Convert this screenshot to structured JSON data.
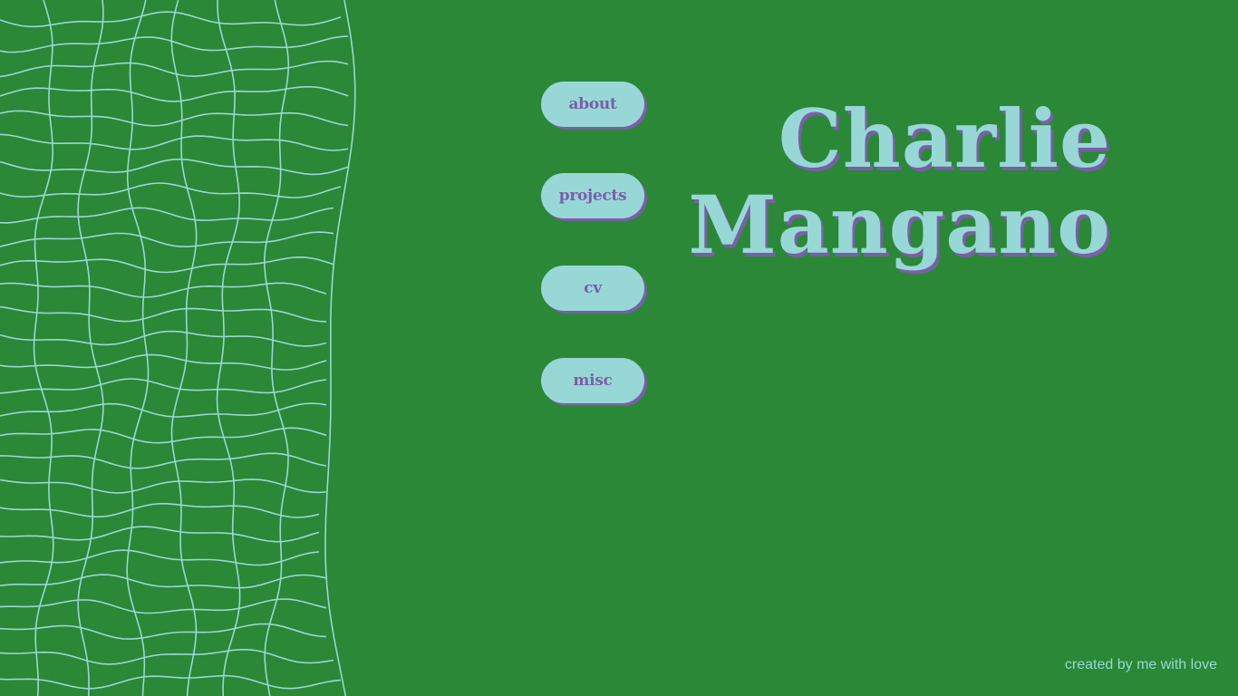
{
  "colors": {
    "background": "#2a8836",
    "accent": "#97d8d6",
    "shadow": "#7a5ea8"
  },
  "decoration": {
    "icon": "wavy-grid-art"
  },
  "nav": {
    "items": [
      {
        "label": "about"
      },
      {
        "label": "projects"
      },
      {
        "label": "cv"
      },
      {
        "label": "misc"
      }
    ]
  },
  "title": {
    "first": "Charlie",
    "last": "Mangano"
  },
  "footer": {
    "text": "created by me with love"
  }
}
